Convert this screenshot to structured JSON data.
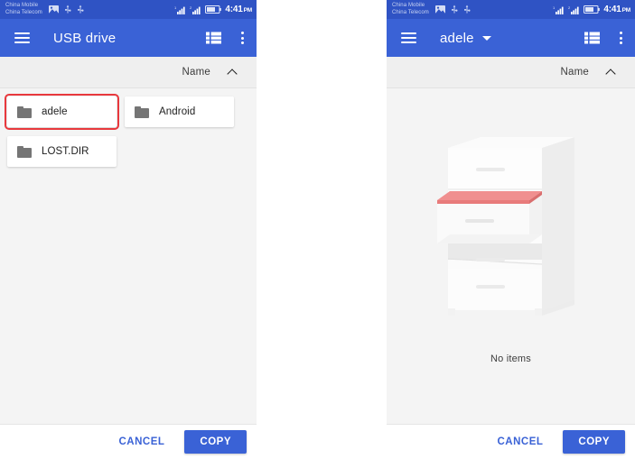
{
  "panels": [
    {
      "id": "left",
      "status_bar": {
        "carrier_line1": "China Mobile",
        "carrier_line2": "China Telecom",
        "icons_left": [
          "image-icon",
          "usb-icon",
          "usb-icon"
        ],
        "icons_right": [
          "signal-bars-icon",
          "signal-bars-icon",
          "battery-icon"
        ],
        "time": "4:41",
        "ampm": "PM"
      },
      "app_bar": {
        "menu_icon": "hamburger-menu-icon",
        "title": "USB drive",
        "has_dropdown": false,
        "view_icon": "list-view-icon",
        "overflow_icon": "more-vertical-icon"
      },
      "sort_bar": {
        "label": "Name",
        "direction_icon": "chevron-up-icon"
      },
      "files": [
        {
          "name": "adele",
          "icon": "folder-icon",
          "highlighted": true
        },
        {
          "name": "Android",
          "icon": "folder-icon",
          "highlighted": false
        },
        {
          "name": "LOST.DIR",
          "icon": "folder-icon",
          "highlighted": false
        }
      ],
      "empty_state": null,
      "bottom_bar": {
        "cancel_label": "CANCEL",
        "confirm_label": "COPY"
      }
    },
    {
      "id": "right",
      "status_bar": {
        "carrier_line1": "China Mobile",
        "carrier_line2": "China Telecom",
        "icons_left": [
          "image-icon",
          "usb-icon",
          "usb-icon"
        ],
        "icons_right": [
          "signal-bars-icon",
          "signal-bars-icon",
          "battery-icon"
        ],
        "time": "4:41",
        "ampm": "PM"
      },
      "app_bar": {
        "menu_icon": "hamburger-menu-icon",
        "title": "adele",
        "has_dropdown": true,
        "view_icon": "list-view-icon",
        "overflow_icon": "more-vertical-icon"
      },
      "sort_bar": {
        "label": "Name",
        "direction_icon": "chevron-up-icon"
      },
      "files": [],
      "empty_state": {
        "illustration": "filing-cabinet-open-drawer-illustration",
        "message": "No items"
      },
      "bottom_bar": {
        "cancel_label": "CANCEL",
        "confirm_label": "COPY"
      }
    }
  ],
  "colors": {
    "status_bar": "#2f53c4",
    "app_bar": "#3a62d6",
    "accent": "#3a62d6",
    "highlight_border": "#e8383d",
    "content_bg": "#f4f4f4",
    "sort_bar_bg": "#efefef",
    "card_bg": "#ffffff",
    "folder_icon": "#757575",
    "illustration_accent": "#ef7f7f"
  }
}
